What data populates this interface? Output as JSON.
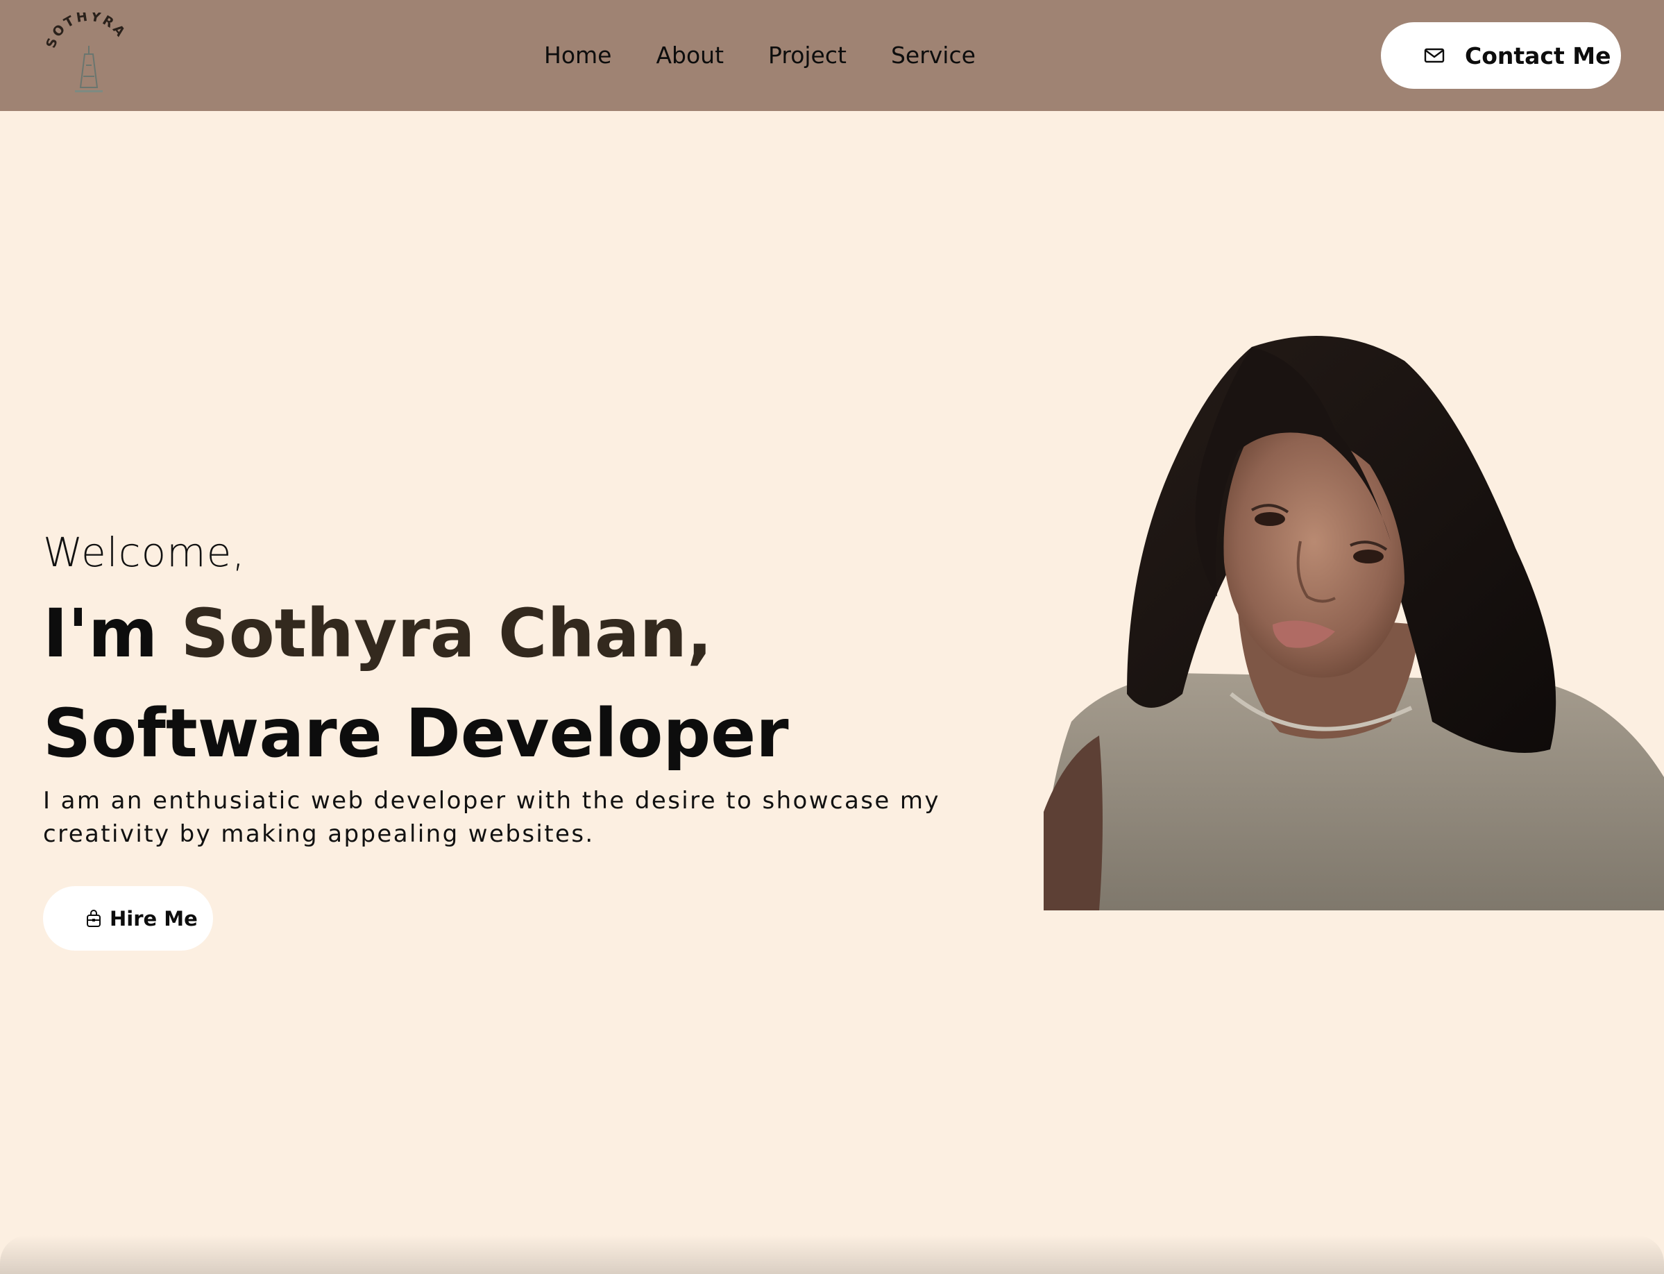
{
  "header": {
    "logo_text": "SOTHYRA",
    "nav": [
      "Home",
      "About",
      "Project",
      "Service"
    ],
    "contact_label": "Contact Me",
    "contact_icon": "mail-icon"
  },
  "hero": {
    "welcome": "Welcome,",
    "intro_prefix": "I'm ",
    "name": "Sothyra Chan,",
    "role": "Software Developer",
    "bio": "I am an enthusiatic web developer with the desire to showcase my creativity by making appealing websites.",
    "hire_label": "Hire Me",
    "hire_icon": "briefcase-icon",
    "portrait": "portrait-photo"
  },
  "colors": {
    "header_bg": "#9f8373",
    "page_bg": "#fcefe1",
    "name_accent": "#33291e",
    "button_bg": "#ffffff"
  }
}
